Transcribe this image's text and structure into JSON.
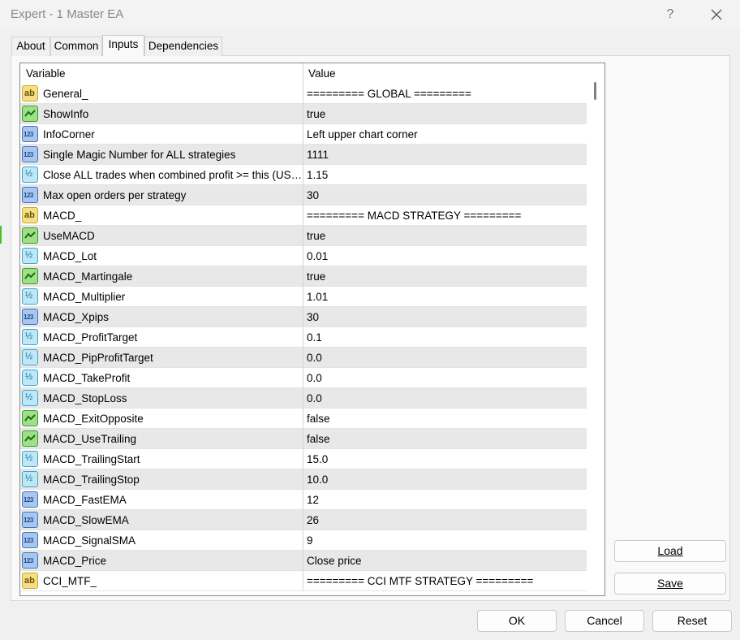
{
  "window": {
    "title": "Expert - 1 Master EA",
    "help_label": "?"
  },
  "tabs": [
    {
      "label": "About"
    },
    {
      "label": "Common"
    },
    {
      "label": "Inputs"
    },
    {
      "label": "Dependencies"
    }
  ],
  "grid": {
    "columns": [
      "Variable",
      "Value"
    ],
    "rows": [
      {
        "icon": "ab",
        "variable": "General_",
        "value": "========= GLOBAL ========="
      },
      {
        "icon": "bool",
        "variable": "ShowInfo",
        "value": "true"
      },
      {
        "icon": "123",
        "variable": "InfoCorner",
        "value": "Left upper chart corner"
      },
      {
        "icon": "123",
        "variable": "Single Magic Number for ALL strategies",
        "value": "1111"
      },
      {
        "icon": "dbl",
        "variable": "Close ALL trades when combined profit >= this (USD...",
        "value": "1.15"
      },
      {
        "icon": "123",
        "variable": "Max open orders per strategy",
        "value": "30"
      },
      {
        "icon": "ab",
        "variable": "MACD_",
        "value": "========= MACD STRATEGY ========="
      },
      {
        "icon": "bool",
        "variable": "UseMACD",
        "value": "true"
      },
      {
        "icon": "dbl",
        "variable": "MACD_Lot",
        "value": "0.01"
      },
      {
        "icon": "bool",
        "variable": "MACD_Martingale",
        "value": "true"
      },
      {
        "icon": "dbl",
        "variable": "MACD_Multiplier",
        "value": "1.01"
      },
      {
        "icon": "123",
        "variable": "MACD_Xpips",
        "value": "30"
      },
      {
        "icon": "dbl",
        "variable": "MACD_ProfitTarget",
        "value": "0.1"
      },
      {
        "icon": "dbl",
        "variable": "MACD_PipProfitTarget",
        "value": "0.0"
      },
      {
        "icon": "dbl",
        "variable": "MACD_TakeProfit",
        "value": "0.0"
      },
      {
        "icon": "dbl",
        "variable": "MACD_StopLoss",
        "value": "0.0"
      },
      {
        "icon": "bool",
        "variable": "MACD_ExitOpposite",
        "value": "false"
      },
      {
        "icon": "bool",
        "variable": "MACD_UseTrailing",
        "value": "false"
      },
      {
        "icon": "dbl",
        "variable": "MACD_TrailingStart",
        "value": "15.0"
      },
      {
        "icon": "dbl",
        "variable": "MACD_TrailingStop",
        "value": "10.0"
      },
      {
        "icon": "123",
        "variable": "MACD_FastEMA",
        "value": "12"
      },
      {
        "icon": "123",
        "variable": "MACD_SlowEMA",
        "value": "26"
      },
      {
        "icon": "123",
        "variable": "MACD_SignalSMA",
        "value": "9"
      },
      {
        "icon": "123",
        "variable": "MACD_Price",
        "value": "Close price"
      },
      {
        "icon": "ab",
        "variable": "CCI_MTF_",
        "value": "========= CCI MTF STRATEGY ========="
      }
    ]
  },
  "icon_text": {
    "ab": "ab",
    "123": "123",
    "dbl": "½"
  },
  "buttons": {
    "load": "Load",
    "save": "Save",
    "ok": "OK",
    "cancel": "Cancel",
    "reset": "Reset"
  },
  "colors": {
    "row_alt": "#e8e8e8",
    "icon_string": "#f3df86",
    "icon_bool": "#9ee08a",
    "icon_int": "#a9c7ee",
    "icon_double": "#bfe7f6"
  }
}
